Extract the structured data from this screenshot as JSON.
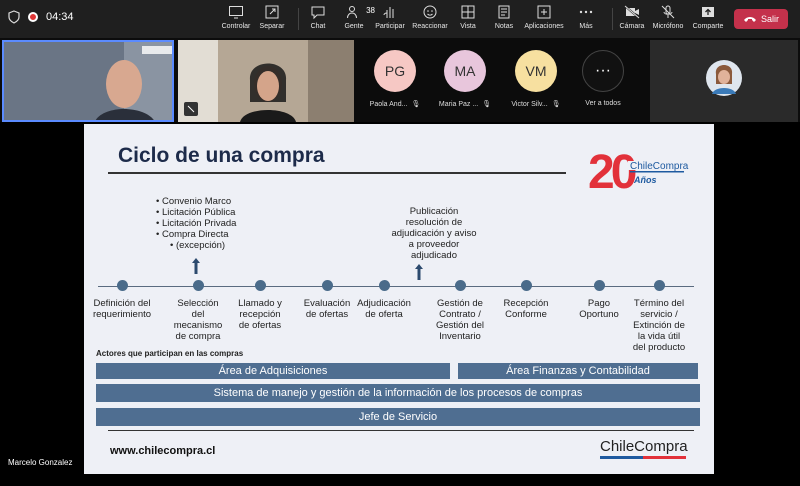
{
  "topbar": {
    "timer": "04:34",
    "buttons": {
      "control": "Controlar",
      "undock": "Separar",
      "chat": "Chat",
      "people": "Gente",
      "people_count": "38",
      "raise": "Participar",
      "react": "Reaccionar",
      "view": "Vista",
      "notes": "Notas",
      "apps": "Aplicaciones",
      "more": "Más",
      "camera": "Cámara",
      "mic": "Micrófono",
      "share": "Comparte"
    },
    "leave": "Salir"
  },
  "participants": [
    {
      "initials": "PG",
      "name": "Paola And...",
      "color": "#f6c8c4"
    },
    {
      "initials": "MA",
      "name": "Maria Paz ...",
      "color": "#e8c6dc"
    },
    {
      "initials": "VM",
      "name": "Victor Silv...",
      "color": "#f7e0a0"
    }
  ],
  "see_all": "Ver a todos",
  "presenter_name": "Marcelo Gonzalez",
  "slide": {
    "title": "Ciclo de una compra",
    "logo_number": "20",
    "logo_brand": "ChileCompra",
    "logo_years": "Años",
    "bullets": [
      "Convenio Marco",
      "Licitación Pública",
      "Licitación Privada",
      "Compra Directa",
      "(excepción)"
    ],
    "publication": [
      "Publicación",
      "resolución de",
      "adjudicación y aviso",
      "a proveedor",
      "adjudicado"
    ],
    "steps": [
      [
        "Definición del",
        "requerimiento"
      ],
      [
        "Selección",
        "del",
        "mecanismo",
        "de compra"
      ],
      [
        "Llamado y",
        "recepción",
        "de ofertas"
      ],
      [
        "Evaluación",
        "de ofertas"
      ],
      [
        "Adjudicación",
        "de oferta"
      ],
      [
        "Gestión de",
        "Contrato /",
        "Gestión del",
        "Inventario"
      ],
      [
        "Recepción",
        "Conforme"
      ],
      [
        "Pago",
        "Oportuno"
      ],
      [
        "Término del",
        "servicio /",
        "Extinción de",
        "la vida útil",
        "del producto"
      ]
    ],
    "actors_title": "Actores que participan en las compras",
    "bands": {
      "adquisiciones": "Área de Adquisiciones",
      "finanzas": "Área Finanzas y Contabilidad",
      "sistema": "Sistema de manejo y gestión de la información de los procesos de compras",
      "jefe": "Jefe de Servicio"
    },
    "url": "www.chilecompra.cl",
    "footer_logo": "ChileCompra"
  },
  "colors": {
    "accent_red": "#c4314b",
    "band_blue": "#4f6e91",
    "logo_red": "#e2313a"
  }
}
